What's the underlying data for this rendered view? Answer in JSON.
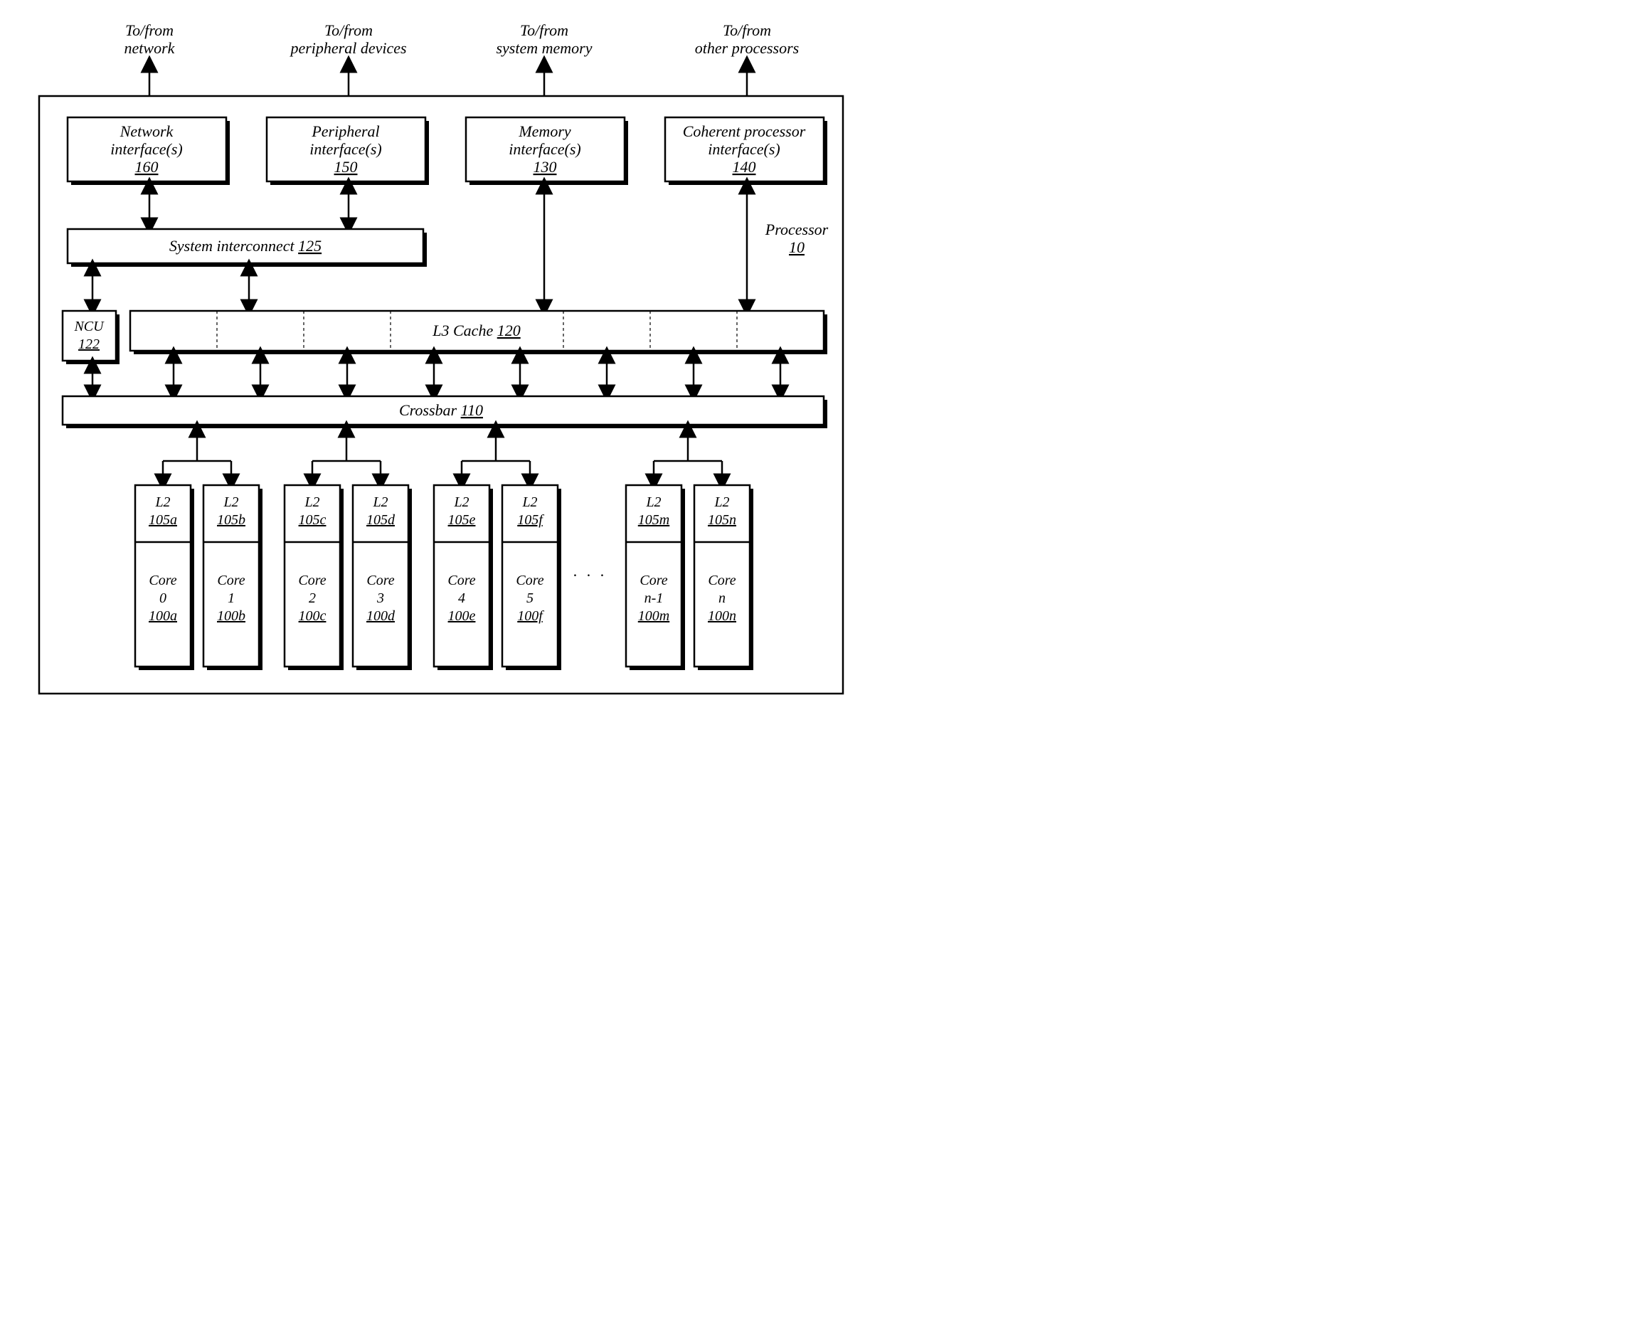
{
  "external": {
    "network": {
      "l1": "To/from",
      "l2": "network"
    },
    "peripheral": {
      "l1": "To/from",
      "l2": "peripheral devices"
    },
    "memory": {
      "l1": "To/from",
      "l2": "system memory"
    },
    "processors": {
      "l1": "To/from",
      "l2": "other processors"
    }
  },
  "interfaces": {
    "network": {
      "l1": "Network",
      "l2": "interface(s)",
      "ref": "160"
    },
    "peripheral": {
      "l1": "Peripheral",
      "l2": "interface(s)",
      "ref": "150"
    },
    "memory": {
      "l1": "Memory",
      "l2": "interface(s)",
      "ref": "130"
    },
    "coherent": {
      "l1": "Coherent processor",
      "l2": "interface(s)",
      "ref": "140"
    }
  },
  "sysint": {
    "label": "System interconnect ",
    "ref": "125"
  },
  "processor": {
    "label": "Processor",
    "ref": "10"
  },
  "ncu": {
    "label": "NCU",
    "ref": "122"
  },
  "l3": {
    "label": "L3 Cache ",
    "ref": "120"
  },
  "crossbar": {
    "label": "Crossbar ",
    "ref": "110"
  },
  "ellipsis": ". . .",
  "cores": [
    {
      "l2": "L2",
      "l2ref": "105a",
      "core": "Core",
      "num": "0",
      "coreref": "100a"
    },
    {
      "l2": "L2",
      "l2ref": "105b",
      "core": "Core",
      "num": "1",
      "coreref": "100b"
    },
    {
      "l2": "L2",
      "l2ref": "105c",
      "core": "Core",
      "num": "2",
      "coreref": "100c"
    },
    {
      "l2": "L2",
      "l2ref": "105d",
      "core": "Core",
      "num": "3",
      "coreref": "100d"
    },
    {
      "l2": "L2",
      "l2ref": "105e",
      "core": "Core",
      "num": "4",
      "coreref": "100e"
    },
    {
      "l2": "L2",
      "l2ref": "105f",
      "core": "Core",
      "num": "5",
      "coreref": "100f"
    },
    {
      "l2": "L2",
      "l2ref": "105m",
      "core": "Core",
      "num": "n-1",
      "coreref": "100m"
    },
    {
      "l2": "L2",
      "l2ref": "105n",
      "core": "Core",
      "num": "n",
      "coreref": "100n"
    }
  ]
}
